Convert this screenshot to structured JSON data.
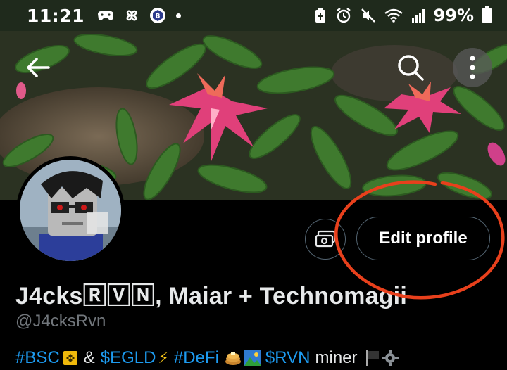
{
  "status_bar": {
    "time": "11:21",
    "battery_percent_label": "99%",
    "battery_level": 0.99
  },
  "nav": {
    "back_icon": "arrow-left-icon",
    "search_icon": "search-icon",
    "more_icon": "more-vertical-icon"
  },
  "profile": {
    "edit_button_label": "Edit profile",
    "display_name": "J4cks🅁🅅🄽, Maiar + Technomagii",
    "handle": "@J4cksRvn",
    "bio": {
      "tag_bsc": "#BSC",
      "amp": "&",
      "tag_egld": "$EGLD",
      "tag_defi": "#DeFi",
      "tag_rvn": "$RVN",
      "miner": "miner"
    }
  },
  "colors": {
    "link": "#1d9bf0",
    "annotation": "#e8401c",
    "muted": "#71767b"
  }
}
